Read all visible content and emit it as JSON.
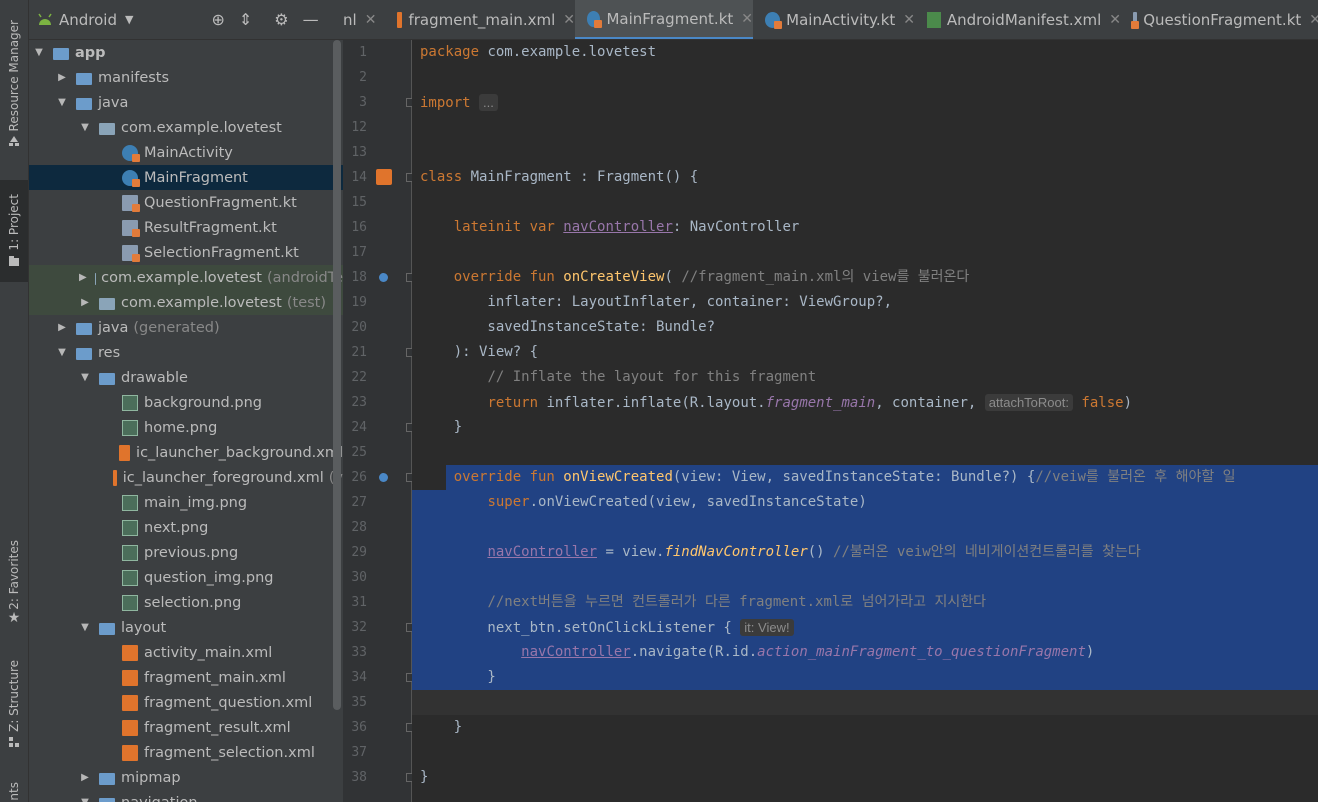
{
  "side_strip": {
    "resource_manager": "Resource Manager",
    "project": "1: Project",
    "favorites": "2: Favorites",
    "structure": "Z: Structure",
    "bottom": "nts"
  },
  "project_panel": {
    "view_mode": "Android",
    "tree": [
      {
        "label": "app",
        "type": "module",
        "depth": 0,
        "expanded": true
      },
      {
        "label": "manifests",
        "type": "folder",
        "depth": 1,
        "expanded": false
      },
      {
        "label": "java",
        "type": "folder",
        "depth": 1,
        "expanded": true
      },
      {
        "label": "com.example.lovetest",
        "type": "package",
        "depth": 2,
        "expanded": true
      },
      {
        "label": "MainActivity",
        "type": "kotlin-class",
        "depth": 3
      },
      {
        "label": "MainFragment",
        "type": "kotlin-class",
        "depth": 3,
        "selected": true
      },
      {
        "label": "QuestionFragment.kt",
        "type": "kotlin-file",
        "depth": 3
      },
      {
        "label": "ResultFragment.kt",
        "type": "kotlin-file",
        "depth": 3
      },
      {
        "label": "SelectionFragment.kt",
        "type": "kotlin-file",
        "depth": 3
      },
      {
        "label": "com.example.lovetest",
        "suffix": "(androidTe",
        "type": "package",
        "depth": 2,
        "expanded": false
      },
      {
        "label": "com.example.lovetest",
        "suffix": "(test)",
        "type": "package",
        "depth": 2,
        "expanded": false
      },
      {
        "label": "java",
        "suffix": "(generated)",
        "type": "folder-gen",
        "depth": 1,
        "expanded": false
      },
      {
        "label": "res",
        "type": "folder-res",
        "depth": 1,
        "expanded": true
      },
      {
        "label": "drawable",
        "type": "folder",
        "depth": 2,
        "expanded": true
      },
      {
        "label": "background.png",
        "type": "image",
        "depth": 3
      },
      {
        "label": "home.png",
        "type": "image",
        "depth": 3
      },
      {
        "label": "ic_launcher_background.xml",
        "type": "xml",
        "depth": 3
      },
      {
        "label": "ic_launcher_foreground.xml",
        "suffix": "(v",
        "type": "xml",
        "depth": 3
      },
      {
        "label": "main_img.png",
        "type": "image",
        "depth": 3
      },
      {
        "label": "next.png",
        "type": "image",
        "depth": 3
      },
      {
        "label": "previous.png",
        "type": "image",
        "depth": 3
      },
      {
        "label": "question_img.png",
        "type": "image",
        "depth": 3
      },
      {
        "label": "selection.png",
        "type": "image",
        "depth": 3
      },
      {
        "label": "layout",
        "type": "folder",
        "depth": 2,
        "expanded": true
      },
      {
        "label": "activity_main.xml",
        "type": "xml",
        "depth": 3
      },
      {
        "label": "fragment_main.xml",
        "type": "xml",
        "depth": 3
      },
      {
        "label": "fragment_question.xml",
        "type": "xml",
        "depth": 3
      },
      {
        "label": "fragment_result.xml",
        "type": "xml",
        "depth": 3
      },
      {
        "label": "fragment_selection.xml",
        "type": "xml",
        "depth": 3
      },
      {
        "label": "mipmap",
        "type": "folder",
        "depth": 2,
        "expanded": false
      },
      {
        "label": "navigation",
        "type": "folder",
        "depth": 2,
        "expanded": true
      }
    ]
  },
  "editor_tabs": [
    {
      "label": "nl",
      "icon": "none",
      "active": false
    },
    {
      "label": "fragment_main.xml",
      "icon": "xml",
      "active": false
    },
    {
      "label": "MainFragment.kt",
      "icon": "kotlin-class",
      "active": true
    },
    {
      "label": "MainActivity.kt",
      "icon": "kotlin-class",
      "active": false
    },
    {
      "label": "AndroidManifest.xml",
      "icon": "manifest",
      "active": false
    },
    {
      "label": "QuestionFragment.kt",
      "icon": "kotlin-file",
      "active": false
    }
  ],
  "code": {
    "line_numbers": [
      "1",
      "2",
      "3",
      "12",
      "13",
      "14",
      "15",
      "16",
      "17",
      "18",
      "19",
      "20",
      "21",
      "22",
      "23",
      "24",
      "25",
      "26",
      "27",
      "28",
      "29",
      "30",
      "31",
      "32",
      "33",
      "34",
      "35",
      "36",
      "37",
      "38"
    ],
    "lines": [
      [
        [
          "kw",
          "package "
        ],
        [
          "",
          "com.example.lovetest"
        ]
      ],
      [],
      [
        [
          "kw",
          "import "
        ],
        [
          "hint",
          "..."
        ]
      ],
      [],
      [],
      [
        [
          "kw",
          "class "
        ],
        [
          "",
          "MainFragment : Fragment() {"
        ]
      ],
      [],
      [
        [
          "",
          "    "
        ],
        [
          "kw",
          "lateinit var "
        ],
        [
          "prop",
          "navController"
        ],
        [
          "",
          ": NavController"
        ]
      ],
      [],
      [
        [
          "",
          "    "
        ],
        [
          "kw",
          "override fun "
        ],
        [
          "fn",
          "onCreateView"
        ],
        [
          "",
          "( "
        ],
        [
          "cm",
          "//fragment_main.xml의 view를 불러온다"
        ]
      ],
      [
        [
          "",
          "        inflater: LayoutInflater, container: ViewGroup?,"
        ]
      ],
      [
        [
          "",
          "        savedInstanceState: Bundle?"
        ]
      ],
      [
        [
          "",
          "    ): View? {"
        ]
      ],
      [
        [
          "",
          "        "
        ],
        [
          "cm",
          "// Inflate the layout for this fragment"
        ]
      ],
      [
        [
          "",
          "        "
        ],
        [
          "kw",
          "return "
        ],
        [
          "",
          "inflater.inflate(R.layout."
        ],
        [
          "it",
          "fragment_main"
        ],
        [
          "",
          ", container, "
        ],
        [
          "hint",
          "attachToRoot:"
        ],
        [
          "kw",
          " false"
        ],
        [
          "",
          ")"
        ]
      ],
      [
        [
          "",
          "    }"
        ]
      ],
      [],
      [
        [
          "",
          "    "
        ],
        [
          "kw",
          "override fun "
        ],
        [
          "fn",
          "onViewCreated"
        ],
        [
          "",
          "(view: View, savedInstanceState: Bundle?) {"
        ],
        [
          "cm",
          "//veiw를 불러온 후 해야할 일"
        ]
      ],
      [
        [
          "",
          "        "
        ],
        [
          "kw",
          "super"
        ],
        [
          "",
          ".onViewCreated(view, savedInstanceState)"
        ]
      ],
      [],
      [
        [
          "",
          "        "
        ],
        [
          "prop",
          "navController"
        ],
        [
          "",
          " = view."
        ],
        [
          "fni",
          "findNavController"
        ],
        [
          "",
          "() "
        ],
        [
          "cm",
          "//불러온 veiw안의 네비게이션컨트롤러를 찾는다"
        ]
      ],
      [],
      [
        [
          "",
          "        "
        ],
        [
          "cm",
          "//next버튼을 누르면 컨트롤러가 다른 fragment.xml로 넘어가라고 지시한다"
        ]
      ],
      [
        [
          "",
          "        next_btn.setOnClickListener { "
        ],
        [
          "hint",
          "it: View!"
        ]
      ],
      [
        [
          "",
          "            "
        ],
        [
          "prop",
          "navController"
        ],
        [
          "",
          ".navigate(R.id."
        ],
        [
          "it",
          "action_mainFragment_to_questionFragment"
        ],
        [
          "",
          ")"
        ]
      ],
      [
        [
          "",
          "        }"
        ]
      ],
      [],
      [
        [
          "",
          "    }"
        ]
      ],
      [],
      [
        [
          "",
          "}"
        ]
      ]
    ]
  },
  "colors": {
    "background": "#2b2b2b",
    "selection": "#214283",
    "keyword": "#cc7832",
    "function": "#ffc66d",
    "comment": "#808080",
    "property": "#9876aa"
  }
}
